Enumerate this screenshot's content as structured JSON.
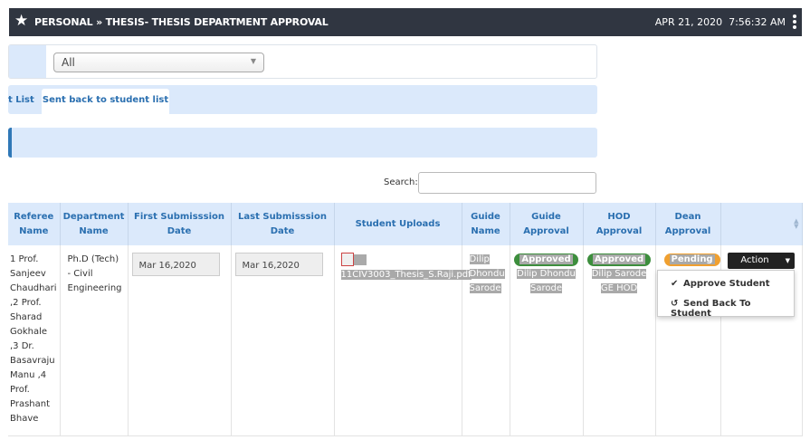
{
  "header": {
    "breadcrumb": "PERSONAL » THESIS- THESIS DEPARTMENT APPROVAL",
    "date": "APR 21, 2020",
    "time": "7:56:32 AM"
  },
  "filter": {
    "selected": "All"
  },
  "tabs": [
    {
      "label": "t List"
    },
    {
      "label": "Sent back to student list"
    }
  ],
  "search": {
    "label": "Search:",
    "value": ""
  },
  "table": {
    "headers": {
      "referee": "Referee Name",
      "department": "Department Name",
      "first": "First Submisssion Date",
      "last": "Last Submisssion Date",
      "uploads": "Student Uploads",
      "guide": "Guide Name",
      "guide_approval": "Guide Approval",
      "hod_approval": "HOD Approval",
      "dean_approval": "Dean Approval"
    },
    "row": {
      "referee": "1 Prof. Sanjeev Chaudhari ,2 Prof. Sharad Gokhale ,3 Dr. Basavraju Manu ,4 Prof. Prashant Bhave",
      "department": "Ph.D (Tech) - Civil Engineering",
      "first": "Mar 16,2020",
      "last": "Mar 16,2020",
      "upload_file": "11CIV3003_Thesis_S.Raji.pdf",
      "guide": "Dilip Dhondu Sarode",
      "guide_status": "Approved",
      "guide_by": "Dilip Dhondu Sarode",
      "hod_status": "Approved",
      "hod_by": "Dilip Sarode GE HOD",
      "dean_status": "Pending"
    }
  },
  "action": {
    "label": "Action",
    "menu": [
      {
        "label": "Approve Student",
        "icon": "check-icon"
      },
      {
        "label": "Send Back To Student",
        "icon": "undo-icon"
      }
    ]
  }
}
